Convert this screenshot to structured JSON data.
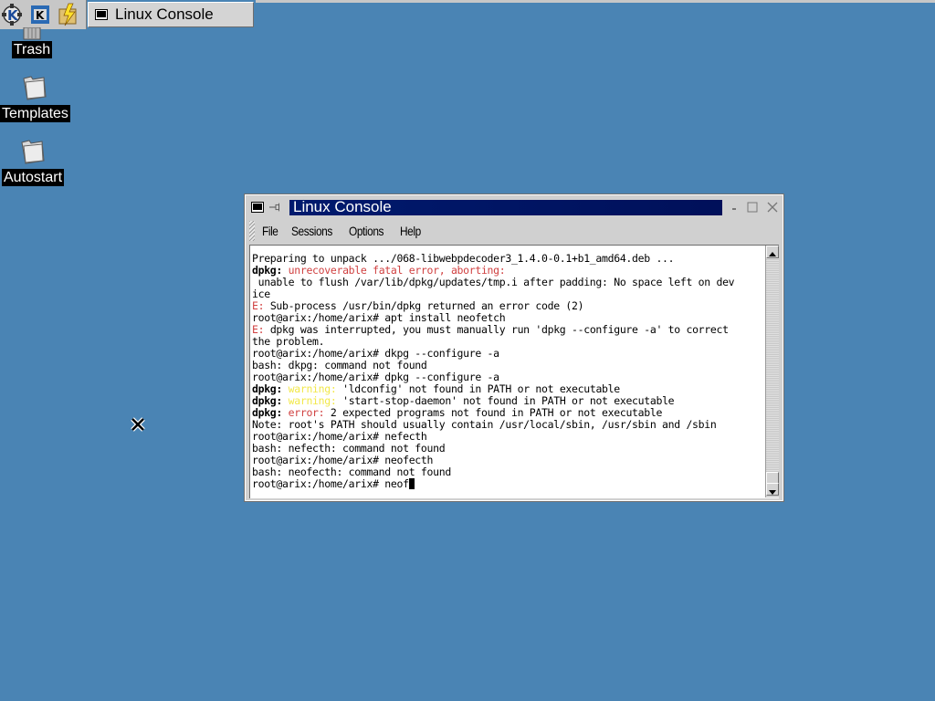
{
  "taskbar": {
    "task_title": "Linux Console"
  },
  "desktop": {
    "icons": [
      {
        "label": "Trash"
      },
      {
        "label": "Templates"
      },
      {
        "label": "Autostart"
      }
    ]
  },
  "window": {
    "title": "Linux Console",
    "menu": [
      "File",
      "Sessions",
      "Options",
      "Help"
    ]
  },
  "terminal": {
    "lines": [
      [
        {
          "t": "Preparing to unpack .../068-libwebpdecoder3_1.4.0-0.1+b1_amd64.deb ..."
        }
      ],
      [
        {
          "t": "dpkg:",
          "c": "b"
        },
        {
          "t": " "
        },
        {
          "t": "unrecoverable fatal error, aborting:",
          "c": "red"
        }
      ],
      [
        {
          "t": " unable to flush /var/lib/dpkg/updates/tmp.i after padding: No space left on dev"
        }
      ],
      [
        {
          "t": "ice"
        }
      ],
      [
        {
          "t": "E:",
          "c": "red"
        },
        {
          "t": " Sub-process /usr/bin/dpkg returned an error code (2)"
        }
      ],
      [
        {
          "t": "root@arix:/home/arix# apt install neofetch"
        }
      ],
      [
        {
          "t": "E:",
          "c": "red"
        },
        {
          "t": " dpkg was interrupted, you must manually run 'dpkg --configure -a' to correct"
        }
      ],
      [
        {
          "t": "the problem."
        }
      ],
      [
        {
          "t": "root@arix:/home/arix# dkpg --configure -a"
        }
      ],
      [
        {
          "t": "bash: dkpg: command not found"
        }
      ],
      [
        {
          "t": "root@arix:/home/arix# dpkg --configure -a"
        }
      ],
      [
        {
          "t": "dpkg:",
          "c": "b"
        },
        {
          "t": " "
        },
        {
          "t": "warning:",
          "c": "yel"
        },
        {
          "t": " 'ldconfig' not found in PATH or not executable"
        }
      ],
      [
        {
          "t": "dpkg:",
          "c": "b"
        },
        {
          "t": " "
        },
        {
          "t": "warning:",
          "c": "yel"
        },
        {
          "t": " 'start-stop-daemon' not found in PATH or not executable"
        }
      ],
      [
        {
          "t": "dpkg:",
          "c": "b"
        },
        {
          "t": " "
        },
        {
          "t": "error:",
          "c": "red"
        },
        {
          "t": " 2 expected programs not found in PATH or not executable"
        }
      ],
      [
        {
          "t": "Note: root's PATH should usually contain /usr/local/sbin, /usr/sbin and /sbin"
        }
      ],
      [
        {
          "t": "root@arix:/home/arix# nefecth"
        }
      ],
      [
        {
          "t": "bash: nefecth: command not found"
        }
      ],
      [
        {
          "t": "root@arix:/home/arix# neofecth"
        }
      ],
      [
        {
          "t": "bash: neofecth: command not found"
        }
      ],
      [
        {
          "t": "root@arix:/home/arix# neof"
        }
      ]
    ]
  },
  "colors": {
    "desktop": "#4a84b4",
    "titlebar_active": "#001a6e",
    "term_red": "#d04040",
    "term_yellow": "#f2e84a"
  },
  "icons": [
    "kde-gear-icon",
    "konqueror-icon",
    "quick-browser-icon",
    "terminal-icon",
    "trash-icon",
    "folder-icon",
    "window-menu-icon",
    "pin-icon",
    "minimize-icon",
    "maximize-icon",
    "close-icon",
    "x-cursor-icon"
  ]
}
